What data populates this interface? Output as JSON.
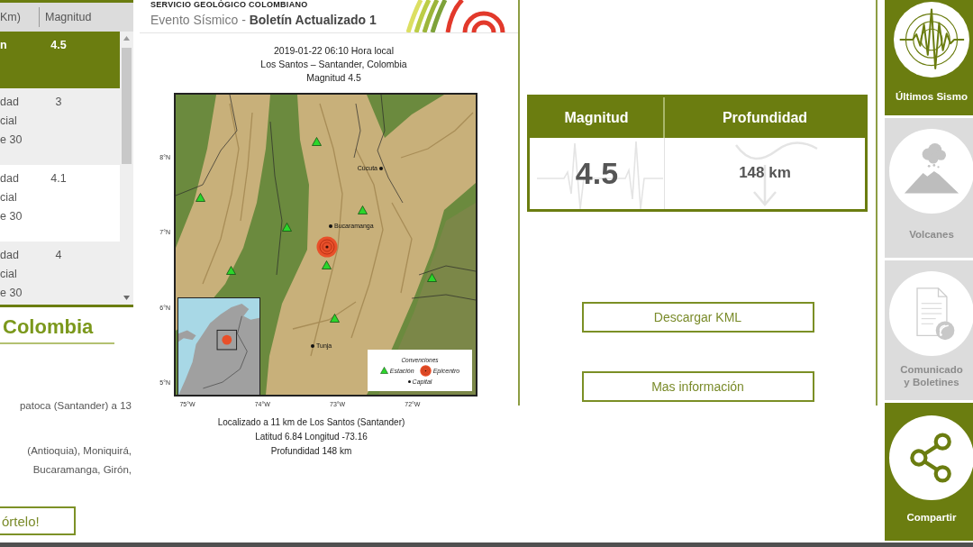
{
  "results_table": {
    "columns": [
      "Km)",
      "Magnitud"
    ],
    "rows": [
      {
        "col_1": "n",
        "magnitude": "4.5",
        "selected": true
      },
      {
        "col_1": "dad\ncial\ne 30",
        "magnitude": "3",
        "selected": false
      },
      {
        "col_1": "dad\ncial\ne 30",
        "magnitude": "4.1",
        "selected": false
      },
      {
        "col_1": "dad\ncial\ne 30",
        "magnitude": "4",
        "selected": false
      }
    ]
  },
  "region": {
    "heading": "Colombia",
    "paragraphs": [
      "patoca (Santander) a 13",
      "(Antioquia), Moniquirá,\nBucaramanga, Girón,"
    ],
    "button": "órtelo!"
  },
  "bulletin": {
    "agency": "SERVICIO GEOLÓGICO COLOMBIANO",
    "subtitle": "Evento Sísmico - **Boletín Actualizado 1**",
    "title_lines": [
      "2019-01-22 06:10 Hora local",
      "Los Santos – Santander, Colombia",
      "Magnitud 4.5"
    ],
    "map": {
      "lat_labels": [
        "8°N",
        "7°N",
        "6°N",
        "5°N"
      ],
      "lon_labels": [
        "75°W",
        "74°W",
        "73°W",
        "72°W"
      ],
      "cities": [
        "Cúcuta",
        "Bucaramanga",
        "Tunja"
      ],
      "legend": {
        "title": "Convenciones",
        "items": [
          {
            "kind": "station",
            "label": "Estación"
          },
          {
            "kind": "epicenter",
            "label": "Epicentro"
          },
          {
            "kind": "capital",
            "label": "Capital"
          }
        ]
      }
    },
    "caption_lines": [
      "Localizado a 11 km de Los Santos (Santander)",
      "Latitud 6.84 Longitud -73.16",
      "Profundidad 148 km"
    ]
  },
  "summary": {
    "columns": [
      {
        "kind": "magnitude",
        "heading": "Magnitud",
        "value": "4.5"
      },
      {
        "kind": "depth",
        "heading": "Profundidad",
        "value": "148 km"
      }
    ]
  },
  "actions": [
    "Descargar KML",
    "Mas información"
  ],
  "nav": {
    "items": [
      {
        "kind": "earthquakes",
        "label": "Últimos Sismo",
        "selected": true
      },
      {
        "kind": "volcanoes",
        "label": "Volcanes",
        "selected": false
      },
      {
        "kind": "bulletins",
        "label": "Comunicado\ny Boletines",
        "selected": false
      }
    ],
    "share": {
      "label": "Compartir"
    }
  }
}
